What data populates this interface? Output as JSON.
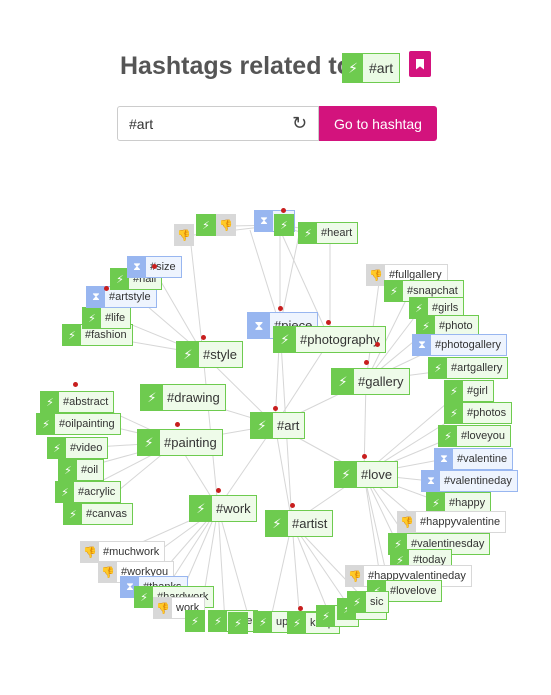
{
  "header": {
    "title": "Hashtags related to",
    "tag_icon": "bolt-icon",
    "tag": "#art",
    "bookmark_icon": "bookmark-icon"
  },
  "search": {
    "value": "#art",
    "reset_icon": "refresh-icon",
    "go_label": "Go to hashtag"
  },
  "colors": {
    "accent": "#d3137d",
    "green": "#6ecb4f",
    "blue": "#98b6f0",
    "gray": "#d8d8d8",
    "edge": "#d6d6d6",
    "dot": "#c81e1e"
  },
  "legend_icons": {
    "green": "bolt-icon",
    "blue": "hourglass-icon",
    "gray": "thumbs-down-icon"
  },
  "graph": {
    "tags": [
      {
        "label": "#fashion",
        "kind": "green"
      },
      {
        "label": "#life",
        "kind": "green"
      },
      {
        "label": "#artstyle",
        "kind": "blue"
      },
      {
        "label": "#nail",
        "kind": "green"
      },
      {
        "label": "#size",
        "kind": "blue"
      },
      {
        "label": "",
        "kind": "gray"
      },
      {
        "label": "",
        "kind": "green"
      },
      {
        "label": "",
        "kind": "gray"
      },
      {
        "label": "#p",
        "kind": "blue"
      },
      {
        "label": "",
        "kind": "green"
      },
      {
        "label": "#heart",
        "kind": "green"
      },
      {
        "label": "#style",
        "kind": "green"
      },
      {
        "label": "#piece",
        "kind": "blue"
      },
      {
        "label": "#photography",
        "kind": "green"
      },
      {
        "label": "#abstract",
        "kind": "green"
      },
      {
        "label": "#oilpainting",
        "kind": "green"
      },
      {
        "label": "#drawing",
        "kind": "green"
      },
      {
        "label": "#painting",
        "kind": "green"
      },
      {
        "label": "#art",
        "kind": "green"
      },
      {
        "label": "#video",
        "kind": "green"
      },
      {
        "label": "#oil",
        "kind": "green"
      },
      {
        "label": "#acrylic",
        "kind": "green"
      },
      {
        "label": "#canvas",
        "kind": "green"
      },
      {
        "label": "#fullgallery",
        "kind": "gray"
      },
      {
        "label": "#snapchat",
        "kind": "green"
      },
      {
        "label": "#girls",
        "kind": "green"
      },
      {
        "label": "#photo",
        "kind": "green"
      },
      {
        "label": "#photogallery",
        "kind": "blue"
      },
      {
        "label": "#artgallery",
        "kind": "green"
      },
      {
        "label": "#gallery",
        "kind": "green"
      },
      {
        "label": "#girl",
        "kind": "green"
      },
      {
        "label": "#photos",
        "kind": "green"
      },
      {
        "label": "#loveyou",
        "kind": "green"
      },
      {
        "label": "#valentine",
        "kind": "blue"
      },
      {
        "label": "#valentineday",
        "kind": "blue"
      },
      {
        "label": "#happy",
        "kind": "green"
      },
      {
        "label": "#love",
        "kind": "green"
      },
      {
        "label": "#happyvalentine",
        "kind": "gray"
      },
      {
        "label": "#valentinesday",
        "kind": "green"
      },
      {
        "label": "#today",
        "kind": "green"
      },
      {
        "label": "#happyvalentineday",
        "kind": "gray"
      },
      {
        "label": "#lovelove",
        "kind": "green"
      },
      {
        "label": "#work",
        "kind": "green"
      },
      {
        "label": "#artist",
        "kind": "green"
      },
      {
        "label": "#muchwork",
        "kind": "gray"
      },
      {
        "label": "#workyou",
        "kind": "gray"
      },
      {
        "label": "#thanks",
        "kind": "blue"
      },
      {
        "label": "#hardwork",
        "kind": "green"
      },
      {
        "label": "work",
        "kind": "gray"
      },
      {
        "label": "",
        "kind": "green"
      },
      {
        "label": "ome",
        "kind": "green"
      },
      {
        "label": "",
        "kind": "green"
      },
      {
        "label": "upartist",
        "kind": "green"
      },
      {
        "label": "keup",
        "kind": "green"
      },
      {
        "label": "sts",
        "kind": "green"
      },
      {
        "label": "oum",
        "kind": "green"
      },
      {
        "label": "sic",
        "kind": "green"
      }
    ]
  }
}
